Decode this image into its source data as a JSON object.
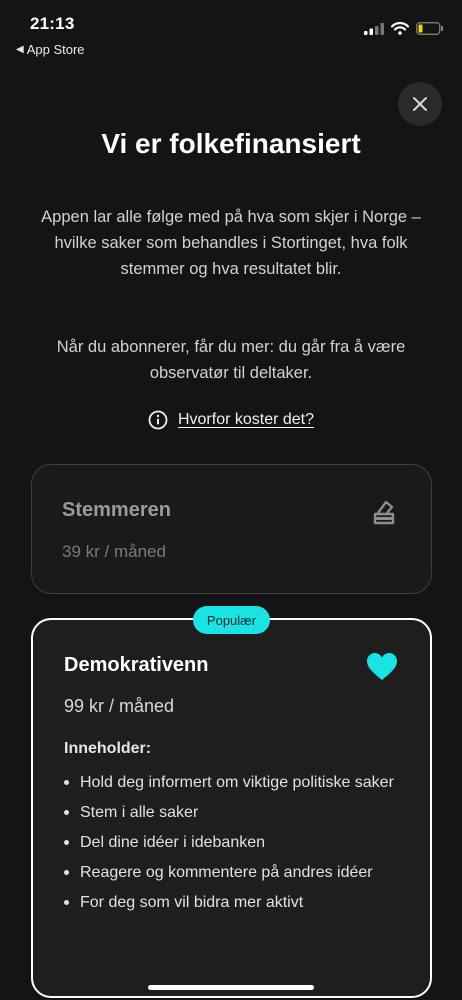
{
  "status": {
    "time": "21:13",
    "back_label": "App Store"
  },
  "header": {
    "title": "Vi er folkefinansiert"
  },
  "intro": {
    "paragraph1": "Appen lar alle følge med på hva som skjer i Norge – hvilke saker som behandles i Stortinget, hva folk stemmer og hva resultatet blir.",
    "paragraph2": "Når du abonnerer, får du mer: du går fra å være observatør til deltaker."
  },
  "why_link": "Hvorfor koster det?",
  "plans": [
    {
      "name": "Stemmeren",
      "price": "39 kr / måned",
      "icon": "ballot-box-icon"
    },
    {
      "badge": "Populær",
      "name": "Demokrativenn",
      "price": "99 kr / måned",
      "icon": "heart-icon",
      "contains_label": "Inneholder:",
      "features": [
        "Hold deg informert om viktige politiske saker",
        "Stem i alle saker",
        "Del dine idéer i idebanken",
        "Reagere og kommentere på andres idéer",
        "For deg som vil bidra mer aktivt"
      ]
    }
  ],
  "colors": {
    "accent": "#19e3e3",
    "background": "#141414"
  }
}
